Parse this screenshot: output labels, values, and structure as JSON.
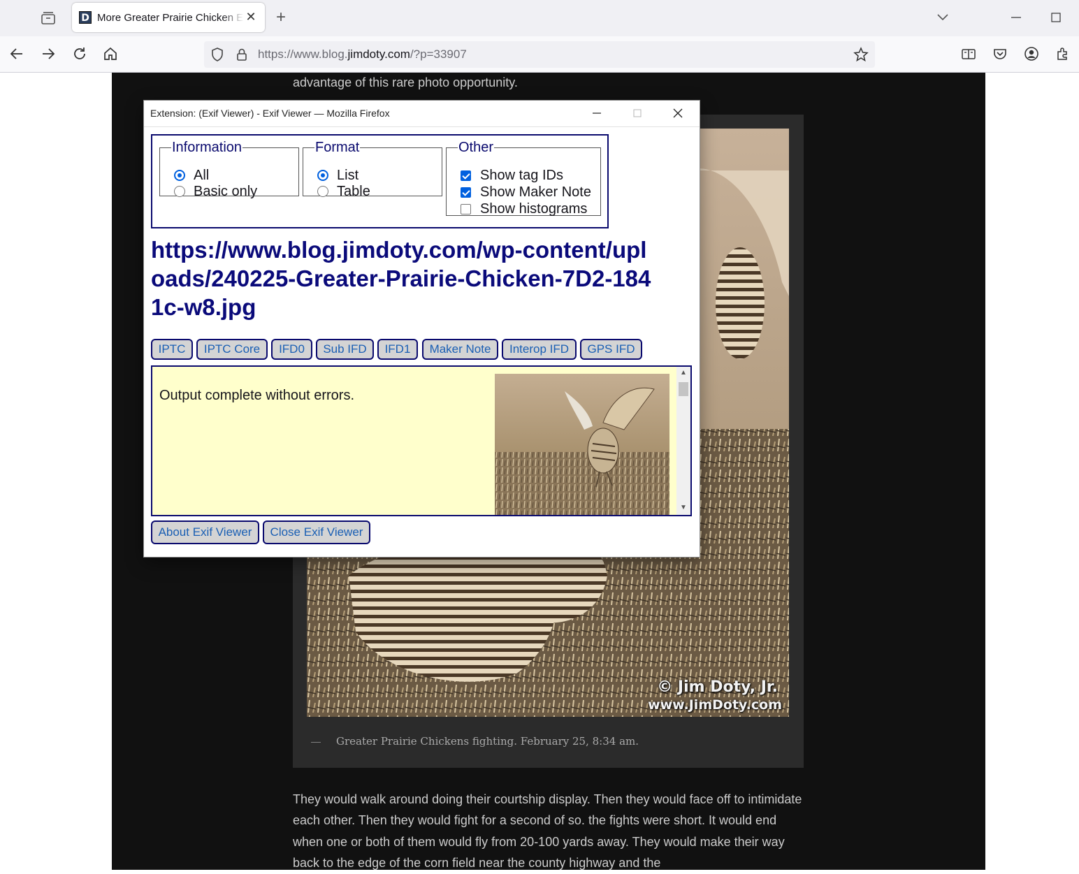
{
  "browser": {
    "tab_title": "More Greater Prairie Chicken Ex",
    "favicon_letter": "D",
    "url_prefix": "https://www.blog.",
    "url_host": "jimdoty.com",
    "url_suffix": "/?p=33907"
  },
  "article": {
    "lead_text": "advantage of this rare photo opportunity.",
    "watermark_line1": "© Jim Doty, Jr.",
    "watermark_line2": "www.JimDoty.com",
    "caption_dash": "—",
    "caption": "Greater Prairie Chickens fighting. February 25, 8:34 am.",
    "body_text": "They would walk around doing their courtship display. Then they would face off to intimidate each other. Then they would fight for a second of so. the fights were short. It would end when one or both of them would fly from 20-100 yards away. They would make their way back to the edge of the corn field near the county highway and the"
  },
  "popup": {
    "title": "Extension: (Exif Viewer) - Exif Viewer — Mozilla Firefox",
    "information": {
      "legend": "Information",
      "options": [
        {
          "label": "All",
          "selected": true
        },
        {
          "label": "Basic only",
          "selected": false
        }
      ]
    },
    "format": {
      "legend": "Format",
      "options": [
        {
          "label": "List",
          "selected": true
        },
        {
          "label": "Table",
          "selected": false
        }
      ]
    },
    "other": {
      "legend": "Other",
      "options": [
        {
          "label": "Show tag IDs",
          "checked": true
        },
        {
          "label": "Show Maker Note",
          "checked": true
        },
        {
          "label": "Show histograms",
          "checked": false
        }
      ]
    },
    "file_url": "https://www.blog.jimdoty.com/wp-content/uploads/240225-Greater-Prairie-Chicken-7D2-1841c-w8.jpg",
    "ifd_tabs": [
      "IPTC",
      "IPTC Core",
      "IFD0",
      "Sub IFD",
      "IFD1",
      "Maker Note",
      "Interop IFD",
      "GPS IFD"
    ],
    "output_text": "Output complete without errors.",
    "about_button": "About Exif Viewer",
    "close_button": "Close Exif Viewer"
  },
  "colors": {
    "accent": "#0060df",
    "dialog_border": "#0a0a6e",
    "output_bg": "#ffffcc",
    "page_bg": "#111111"
  }
}
